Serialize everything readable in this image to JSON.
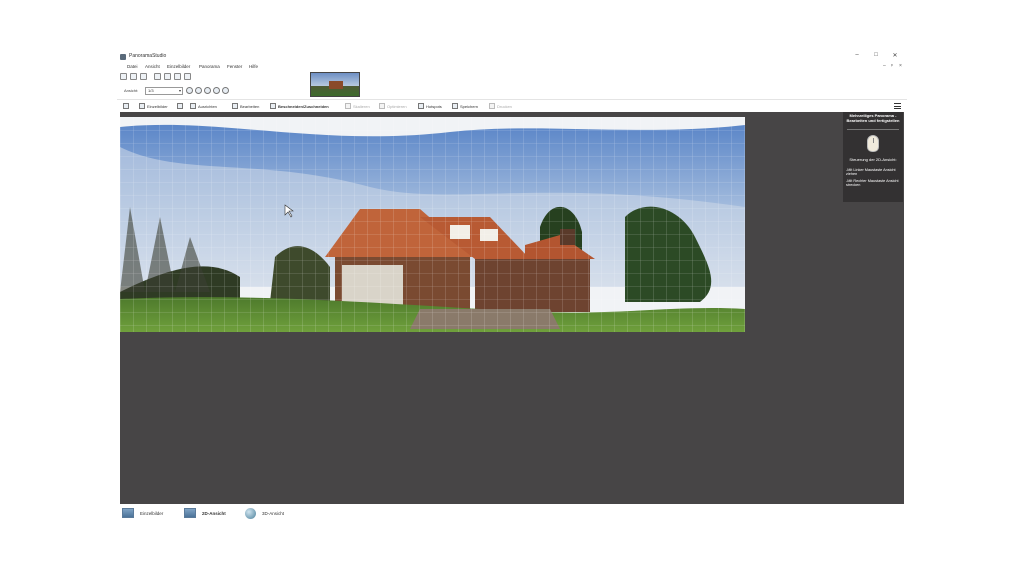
{
  "window": {
    "title": "PanoramaStudio",
    "controls": {
      "minimize": "–",
      "maximize": "□",
      "close": "✕"
    },
    "mdi_controls": {
      "minimize": "–",
      "restore": "ᵖ",
      "close": "×"
    }
  },
  "menu": {
    "items": [
      {
        "label": "Datei"
      },
      {
        "label": "Ansicht"
      },
      {
        "label": "Einzelbilder"
      },
      {
        "label": "Panorama"
      },
      {
        "label": "Fenster"
      },
      {
        "label": "Hilfe"
      }
    ]
  },
  "toolbar": {
    "icons": [
      "new-icon",
      "open-icon",
      "save-icon",
      "import-icon",
      "export-icon",
      "settings-icon",
      "info-icon"
    ]
  },
  "zoom": {
    "label": "Ansicht:",
    "value": "1/3",
    "icons": [
      "zoom-in-icon",
      "zoom-out-icon",
      "zoom-fit-icon",
      "zoom-100-icon",
      "zoom-window-icon"
    ]
  },
  "actions": [
    {
      "label": "Einzelbilder",
      "state": "normal",
      "icon": "images-icon"
    },
    {
      "label": "Ausrichten",
      "state": "normal",
      "icon": "align-icon"
    },
    {
      "label": "Bearbeiten",
      "state": "normal",
      "icon": "edit-icon"
    },
    {
      "label": "Beschneiden/Zuschneiden",
      "state": "active",
      "icon": "crop-icon"
    },
    {
      "label": "Skalieren",
      "state": "disabled",
      "icon": "scale-icon"
    },
    {
      "label": "Optimieren",
      "state": "disabled",
      "icon": "optimize-icon"
    },
    {
      "label": "Hotspots",
      "state": "normal",
      "icon": "hotspot-icon"
    },
    {
      "label": "Speichern",
      "state": "normal",
      "icon": "save-icon"
    },
    {
      "label": "Drucken",
      "state": "disabled",
      "icon": "print-icon"
    }
  ],
  "info_panel": {
    "title": "Mehrzeiliges Panorama - Bearbeiten und fertigstellen",
    "subtitle": "Steuerung der 2D-Ansicht:",
    "line1": "-Mit Linker Maustaste Ansicht ziehen",
    "line2": "-Mit Rechter Maustaste Ansicht strecken",
    "icon": "mouse-icon"
  },
  "bottom_tabs": [
    {
      "label": "Einzelbilder",
      "icon": "images-grid-icon",
      "state": "normal"
    },
    {
      "label": "2D-Ansicht",
      "icon": "panorama-2d-icon",
      "state": "active"
    },
    {
      "label": "3D-Ansicht",
      "icon": "globe-3d-icon",
      "state": "normal"
    }
  ],
  "colors": {
    "workspace": "#474546",
    "panel": "#333132",
    "accent": "#5a7a9a"
  }
}
